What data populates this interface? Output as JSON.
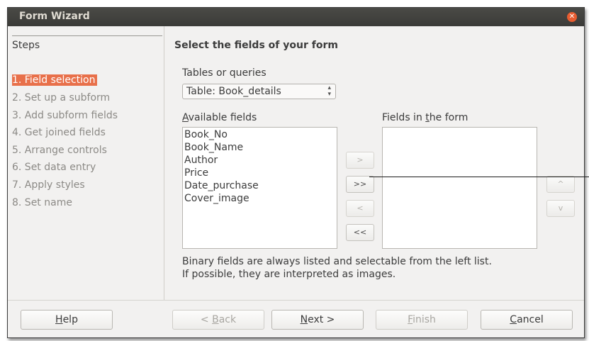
{
  "window": {
    "title": "Form Wizard"
  },
  "steps": {
    "title": "Steps",
    "items": [
      "1. Field selection",
      "2. Set up a subform",
      "3. Add subform fields",
      "4. Get joined fields",
      "5. Arrange controls",
      "6. Set data entry",
      "7. Apply styles",
      "8. Set name"
    ],
    "active_index": 0
  },
  "main": {
    "heading": "Select the fields of your form",
    "tables_label": "Tables or queries",
    "table_selected": "Table: Book_details",
    "available": {
      "label_prefix": "",
      "label_u": "A",
      "label_rest": "vailable fields",
      "items": [
        "Book_No",
        "Book_Name",
        "Author",
        "Price",
        "Date_purchase",
        "Cover_image"
      ]
    },
    "inform": {
      "label_prefix": "Fields in ",
      "label_u": "t",
      "label_rest": "he form",
      "items": []
    },
    "move_buttons": {
      "add_one": ">",
      "add_all": ">>",
      "remove_one": "<",
      "remove_all": "<<"
    },
    "order_buttons": {
      "up": "^",
      "down": "v"
    },
    "hint_line1": "Binary fields are always listed and selectable from the left list.",
    "hint_line2": "If possible, they are interpreted as images."
  },
  "buttons": {
    "help": {
      "u": "H",
      "rest": "elp"
    },
    "back": {
      "pre": "< ",
      "u": "B",
      "rest": "ack"
    },
    "next": {
      "pre": "",
      "u": "N",
      "rest": "ext >"
    },
    "finish": {
      "pre": "",
      "u": "F",
      "rest": "inish"
    },
    "cancel": {
      "pre": "",
      "u": "C",
      "rest": "ancel"
    }
  }
}
